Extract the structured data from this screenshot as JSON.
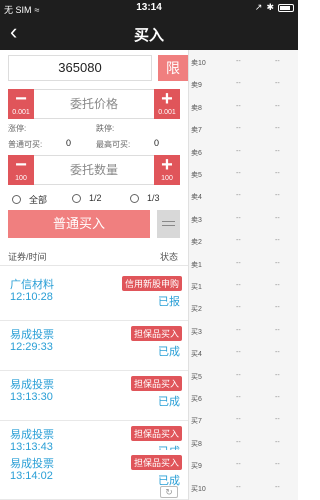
{
  "status_bar": {
    "carrier": "无 SIM",
    "wifi": "≈",
    "time": "13:14",
    "location": "↗",
    "bt": "✱"
  },
  "header": {
    "back": "‹",
    "title": "买入"
  },
  "form": {
    "code": "365080",
    "limit_label": "限",
    "price": {
      "placeholder": "委托价格",
      "minus_step": "0.001",
      "plus_step": "0.001"
    },
    "qty": {
      "placeholder": "委托数量",
      "minus_step": "100",
      "plus_step": "100"
    },
    "info": {
      "limit_up_label": "涨停:",
      "limit_down_label": "跌停:",
      "normal_buyable_label": "普通可买:",
      "normal_buyable": "0",
      "max_buyable_label": "最高可买:",
      "max_buyable": "0"
    },
    "ratios": [
      "全部",
      "1/2",
      "1/3"
    ],
    "buy_label": "普通买入"
  },
  "list": {
    "col_stock_time": "证券/时间",
    "col_status": "状态",
    "orders": [
      {
        "name": "广信材料",
        "time": "12:10:28",
        "tag": "信用新股申购",
        "state": "已报"
      },
      {
        "name": "易成投票",
        "time": "12:29:33",
        "tag": "担保品买入",
        "state": "已成"
      },
      {
        "name": "易成投票",
        "time": "13:13:30",
        "tag": "担保品买入",
        "state": "已成"
      },
      {
        "name": "易成投票",
        "time": "13:13:43",
        "tag": "担保品买入",
        "state": "已成"
      },
      {
        "name": "易成投票",
        "time": "13:14:02",
        "tag": "担保品买入",
        "state": "已成"
      }
    ]
  },
  "order_book": [
    {
      "label": "卖10",
      "price": "--",
      "vol": "--"
    },
    {
      "label": "卖9",
      "price": "--",
      "vol": "--"
    },
    {
      "label": "卖8",
      "price": "--",
      "vol": "--"
    },
    {
      "label": "卖7",
      "price": "--",
      "vol": "--"
    },
    {
      "label": "卖6",
      "price": "--",
      "vol": "--"
    },
    {
      "label": "卖5",
      "price": "--",
      "vol": "--"
    },
    {
      "label": "卖4",
      "price": "--",
      "vol": "--"
    },
    {
      "label": "卖3",
      "price": "--",
      "vol": "--"
    },
    {
      "label": "卖2",
      "price": "--",
      "vol": "--"
    },
    {
      "label": "卖1",
      "price": "--",
      "vol": "--"
    },
    {
      "label": "买1",
      "price": "--",
      "vol": "--"
    },
    {
      "label": "买2",
      "price": "--",
      "vol": "--"
    },
    {
      "label": "买3",
      "price": "--",
      "vol": "--"
    },
    {
      "label": "买4",
      "price": "--",
      "vol": "--"
    },
    {
      "label": "买5",
      "price": "--",
      "vol": "--"
    },
    {
      "label": "买6",
      "price": "--",
      "vol": "--"
    },
    {
      "label": "买7",
      "price": "--",
      "vol": "--"
    },
    {
      "label": "买8",
      "price": "--",
      "vol": "--"
    },
    {
      "label": "买9",
      "price": "--",
      "vol": "--"
    },
    {
      "label": "买10",
      "price": "--",
      "vol": "--"
    }
  ],
  "colors": {
    "accent": "#e0555a",
    "accent_light": "#f07f7f",
    "link_blue": "#2a9fd6",
    "header_bg": "#1e1e1e"
  }
}
